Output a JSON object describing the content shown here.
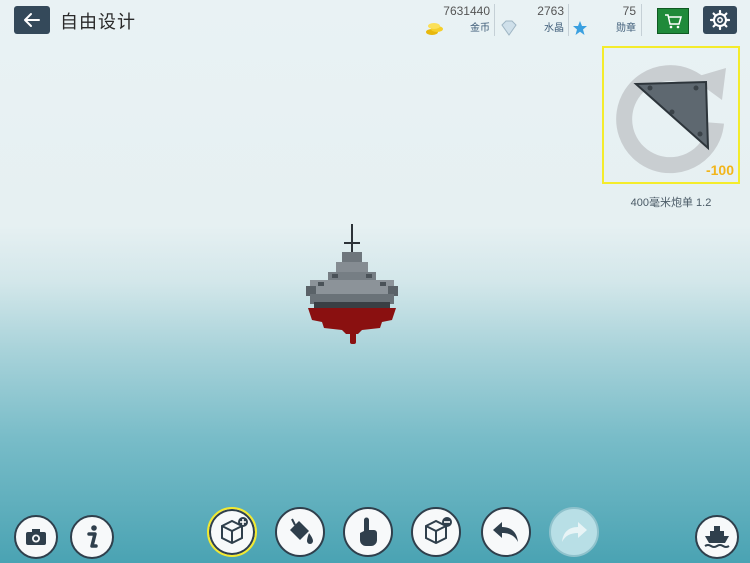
{
  "header": {
    "title": "自由设计",
    "gold": {
      "value": "7631440",
      "label": "金币"
    },
    "crystal": {
      "value": "2763",
      "label": "水晶"
    },
    "medal": {
      "value": "75",
      "label": "勋章"
    }
  },
  "part_panel": {
    "count": "-100",
    "name": "400毫米炮单 1.2"
  },
  "icons": {
    "back": "back-arrow-icon",
    "cart": "shopping-cart-icon",
    "settings": "gear-icon",
    "camera": "camera-icon",
    "info": "info-icon",
    "add_block": "add-block-icon",
    "paint": "paint-bucket-icon",
    "select": "hand-pointer-icon",
    "remove_block": "remove-block-icon",
    "undo": "undo-icon",
    "redo": "redo-icon",
    "ship": "ship-icon"
  },
  "colors": {
    "accent_yellow": "#f4ec2c",
    "cart_green": "#1f8a3a",
    "button_dark": "#34495a",
    "hull_red": "#8a1010"
  }
}
